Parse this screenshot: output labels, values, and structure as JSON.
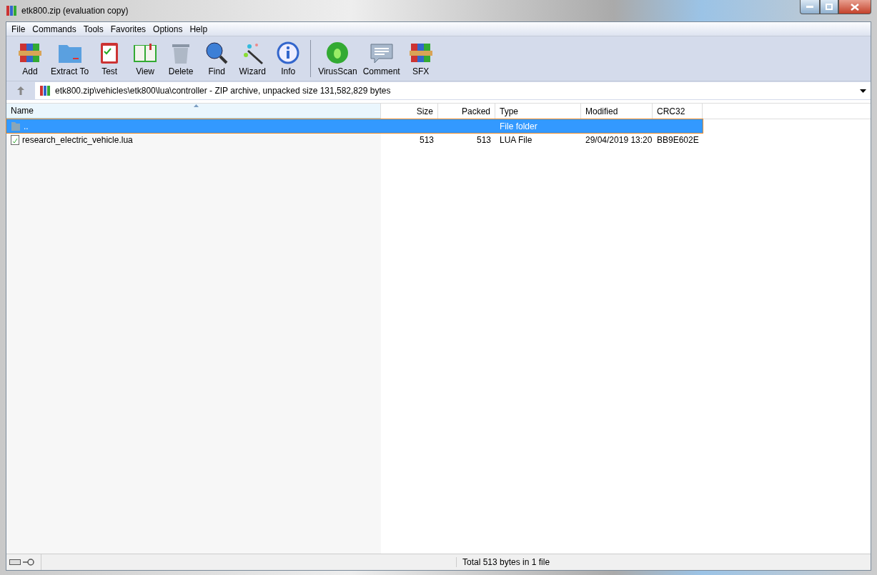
{
  "window": {
    "title": "etk800.zip (evaluation copy)"
  },
  "menu": [
    "File",
    "Commands",
    "Tools",
    "Favorites",
    "Options",
    "Help"
  ],
  "toolbar": [
    {
      "kind": "add",
      "label": "Add"
    },
    {
      "kind": "extract",
      "label": "Extract To"
    },
    {
      "kind": "test",
      "label": "Test"
    },
    {
      "kind": "view",
      "label": "View"
    },
    {
      "kind": "delete",
      "label": "Delete"
    },
    {
      "kind": "find",
      "label": "Find"
    },
    {
      "kind": "wizard",
      "label": "Wizard"
    },
    {
      "kind": "info",
      "label": "Info"
    },
    {
      "kind": "separator"
    },
    {
      "kind": "virus",
      "label": "VirusScan"
    },
    {
      "kind": "comment",
      "label": "Comment"
    },
    {
      "kind": "sfx",
      "label": "SFX"
    }
  ],
  "address": "etk800.zip\\vehicles\\etk800\\lua\\controller - ZIP archive, unpacked size 131,582,829 bytes",
  "table": {
    "columns": [
      {
        "label": "Name",
        "sorted": true
      },
      {
        "label": "Size",
        "sorted": false
      },
      {
        "label": "Packed",
        "sorted": false
      },
      {
        "label": "Type",
        "sorted": false
      },
      {
        "label": "Modified",
        "sorted": false
      },
      {
        "label": "CRC32",
        "sorted": false
      }
    ],
    "rows": [
      {
        "kind": "folder",
        "selected": true,
        "cells": [
          "..",
          "",
          "",
          "File folder",
          "",
          ""
        ]
      },
      {
        "kind": "file",
        "selected": false,
        "cells": [
          "research_electric_vehicle.lua",
          "513",
          "513",
          "LUA File",
          "29/04/2019 13:20",
          "BB9E602E"
        ]
      }
    ]
  },
  "status_bar": {
    "text": "Total 513 bytes in 1 file"
  }
}
